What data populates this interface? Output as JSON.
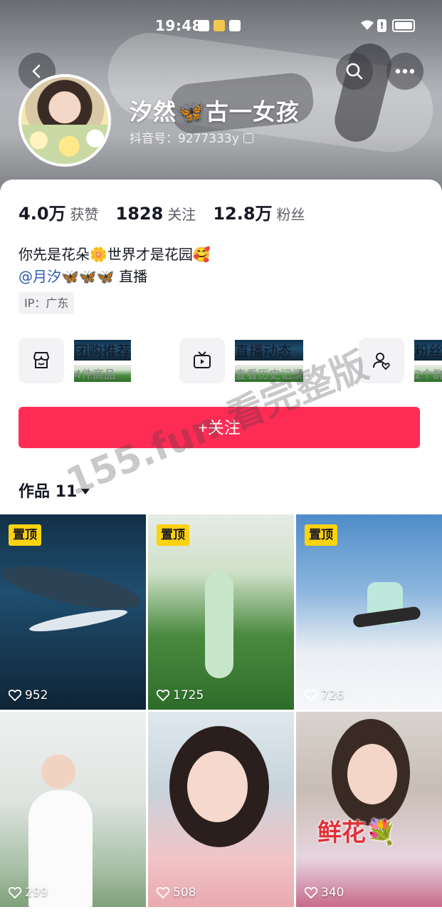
{
  "status_bar": {
    "time": "19:48"
  },
  "profile": {
    "name": "汐然🦋古一女孩",
    "douyin_id": "抖音号：9277333y",
    "stats": [
      {
        "value": "4.0万",
        "label": "获赞"
      },
      {
        "value": "1828",
        "label": "关注"
      },
      {
        "value": "12.8万",
        "label": "粉丝"
      }
    ],
    "bio_line1": "你先是花朵🌼世界才是花园🥰",
    "bio_mention": "@月汐🦋🦋🦋",
    "bio_mention_suffix": " 直播",
    "ip_location": "IP：广东"
  },
  "shortcuts": [
    {
      "title": "团购推荐",
      "subtitle": "4件商品",
      "icon": "shop-icon"
    },
    {
      "title": "直播动态",
      "subtitle": "查看历史记录",
      "icon": "tv-icon"
    },
    {
      "title": "粉丝",
      "subtitle": "2个群",
      "icon": "fans-icon"
    }
  ],
  "follow_button": "+关注",
  "works_tab": {
    "label": "作品 11"
  },
  "watermark": "155.fun 看完整版",
  "videos": [
    {
      "pinned_label": "置顶",
      "likes": "952"
    },
    {
      "pinned_label": "置顶",
      "likes": "1725"
    },
    {
      "pinned_label": "置顶",
      "likes": "726"
    },
    {
      "likes": "299"
    },
    {
      "likes": "508"
    },
    {
      "likes": "340",
      "overlay_text": "鲜花💐"
    }
  ]
}
